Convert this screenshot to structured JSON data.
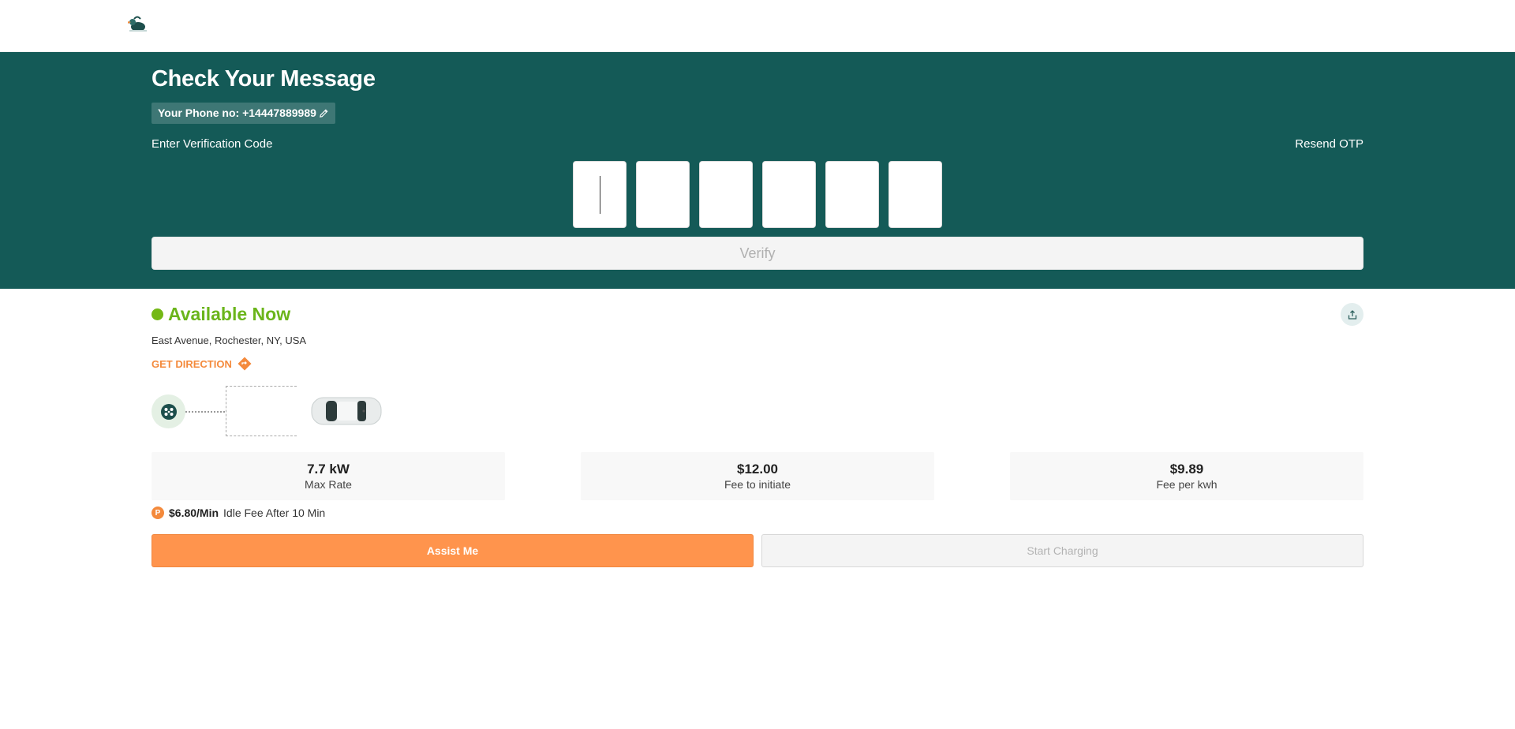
{
  "header": {
    "logo_icon": "bird-logo-icon"
  },
  "verification": {
    "title": "Check Your Message",
    "phone_label": "Your Phone no: +14447889989",
    "enter_label": "Enter Verification Code",
    "resend_label": "Resend OTP",
    "otp_digits": [
      "",
      "",
      "",
      "",
      "",
      ""
    ],
    "verify_label": "Verify"
  },
  "station": {
    "status": "Available Now",
    "status_color": "#74b816",
    "address": "East Avenue, Rochester, NY, USA",
    "direction_label": "GET DIRECTION",
    "stats": [
      {
        "value": "7.7 kW",
        "label": "Max Rate"
      },
      {
        "value": "$12.00",
        "label": "Fee to initiate"
      },
      {
        "value": "$9.89",
        "label": "Fee per kwh"
      }
    ],
    "idle_badge": "P",
    "idle_price": "$6.80/Min",
    "idle_text": "Idle Fee After 10 Min"
  },
  "actions": {
    "assist_label": "Assist Me",
    "start_label": "Start Charging",
    "accent": "#ff944d"
  }
}
